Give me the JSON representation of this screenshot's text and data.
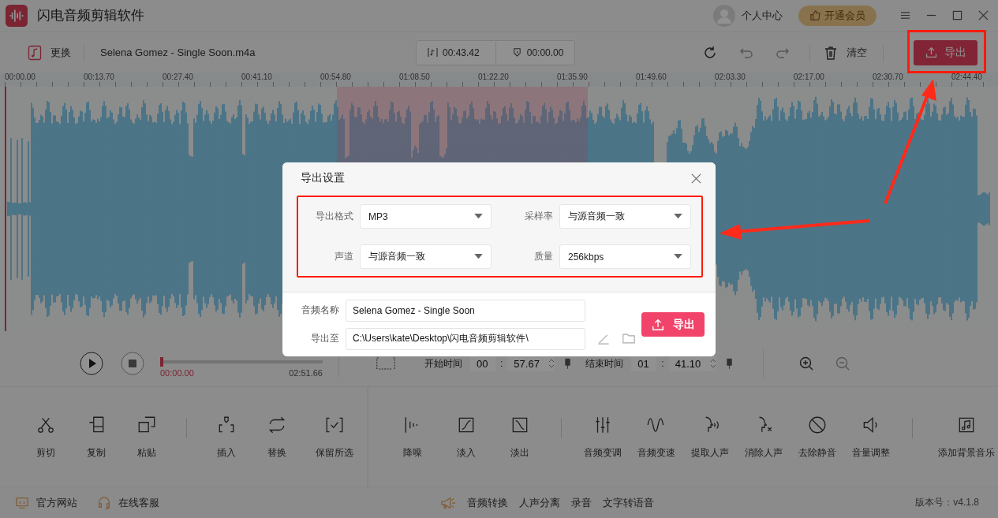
{
  "app": {
    "title": "闪电音频剪辑软件"
  },
  "account": {
    "user_label": "个人中心",
    "vip_button": "开通会员"
  },
  "toolbar": {
    "replace_label": "更换",
    "file_name": "Selena Gomez - Single Soon.m4a",
    "duration": "00:43.42",
    "position": "00:00.00",
    "clear_label": "清空",
    "export_button": "导出"
  },
  "ruler": {
    "labels": [
      "00:00.00",
      "00:13.70",
      "00:27.40",
      "00:41.10",
      "00:54.80",
      "01:08.50",
      "01:22.20",
      "01:35.90",
      "01:49.60",
      "02:03.30",
      "02:17.00",
      "02:30.70",
      "02:44.40"
    ]
  },
  "player": {
    "level": 0,
    "current_time": "00:00.00",
    "total_time": "02:51.66",
    "start_label": "开始时间",
    "start_min": "00",
    "start_separator": ":",
    "start_sec": "57.67",
    "end_label": "结束时间",
    "end_min": "01",
    "end_separator": ":",
    "end_sec": "41.10"
  },
  "tool_panels": [
    {
      "groups": [
        {
          "tools": [
            {
              "label": "剪切"
            },
            {
              "label": "复制"
            },
            {
              "label": "粘贴"
            }
          ]
        },
        {
          "tools": [
            {
              "label": "插入"
            },
            {
              "label": "替换"
            },
            {
              "label": "保留所选"
            }
          ]
        }
      ]
    },
    {
      "groups": [
        {
          "tools": [
            {
              "label": "降噪"
            },
            {
              "label": "淡入"
            },
            {
              "label": "淡出"
            }
          ]
        },
        {
          "tools": [
            {
              "label": "音频变调"
            },
            {
              "label": "音频变速"
            },
            {
              "label": "提取人声"
            },
            {
              "label": "消除人声"
            },
            {
              "label": "去除静音"
            },
            {
              "label": "音量调整"
            }
          ]
        },
        {
          "tools": [
            {
              "label": "添加背景音乐"
            }
          ]
        }
      ]
    }
  ],
  "footer": {
    "left_links": [
      "官方网站",
      "在线客服"
    ],
    "center_links": [
      "音频转换",
      "人声分离",
      "录音",
      "文字转语音"
    ],
    "version": "版本号：v4.1.8"
  },
  "dialog": {
    "title": "导出设置",
    "settings": [
      {
        "label": "导出格式",
        "value": "MP3"
      },
      {
        "label": "采样率",
        "value": "与源音频一致"
      },
      {
        "label": "声道",
        "value": "与源音频一致"
      },
      {
        "label": "质量",
        "value": "256kbps"
      }
    ],
    "name_label": "音频名称",
    "name_value": "Selena Gomez - Single Soon",
    "path_label": "导出至",
    "path_value": "C:\\Users\\kate\\Desktop\\闪电音频剪辑软件\\",
    "export_button": "导出"
  }
}
